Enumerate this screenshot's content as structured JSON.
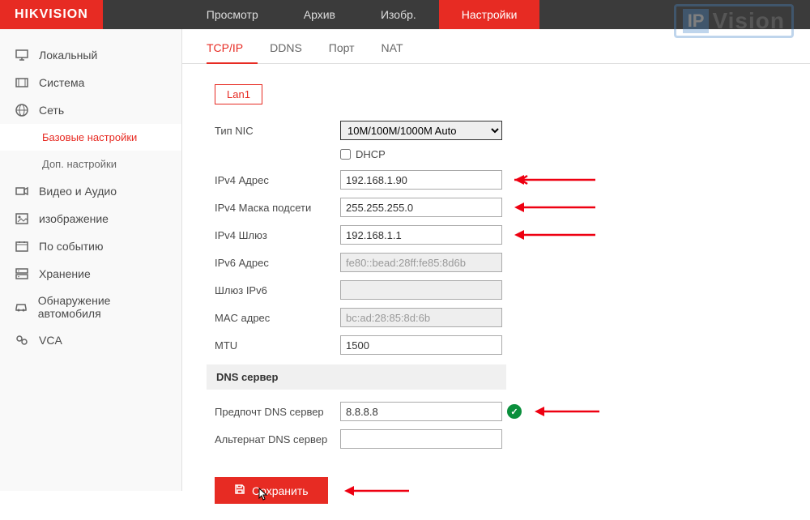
{
  "logo": {
    "part1": "HIK",
    "part2": "VISION"
  },
  "nav": {
    "items": [
      "Просмотр",
      "Архив",
      "Изобр.",
      "Настройки"
    ],
    "activeIndex": 3
  },
  "sidebar": {
    "items": [
      {
        "label": "Локальный",
        "icon": "monitor"
      },
      {
        "label": "Система",
        "icon": "film"
      },
      {
        "label": "Сеть",
        "icon": "globe",
        "children": [
          {
            "label": "Базовые настройки",
            "active": true
          },
          {
            "label": "Доп. настройки",
            "active": false
          }
        ]
      },
      {
        "label": "Видео и Аудио",
        "icon": "video"
      },
      {
        "label": "изображение",
        "icon": "image"
      },
      {
        "label": "По событию",
        "icon": "calendar"
      },
      {
        "label": "Хранение",
        "icon": "storage"
      },
      {
        "label": "Обнаружение автомобиля",
        "icon": "car"
      },
      {
        "label": "VCA",
        "icon": "vca"
      }
    ]
  },
  "tabs": {
    "items": [
      "TCP/IP",
      "DDNS",
      "Порт",
      "NAT"
    ],
    "activeIndex": 0
  },
  "lan": {
    "label": "Lan1"
  },
  "form": {
    "nicType": {
      "label": "Тип NIC",
      "value": "10M/100M/1000M Auto"
    },
    "dhcp": {
      "label": "DHCP",
      "checked": false
    },
    "ipv4Address": {
      "label": "IPv4 Адрес",
      "value": "192.168.1.90"
    },
    "ipv4Mask": {
      "label": "IPv4 Маска подсети",
      "value": "255.255.255.0"
    },
    "ipv4Gateway": {
      "label": "IPv4 Шлюз",
      "value": "192.168.1.1"
    },
    "ipv6Address": {
      "label": "IPv6 Адрес",
      "value": "fe80::bead:28ff:fe85:8d6b"
    },
    "ipv6Gateway": {
      "label": "Шлюз IPv6",
      "value": ""
    },
    "macAddress": {
      "label": "MAC адрес",
      "value": "bc:ad:28:85:8d:6b"
    },
    "mtu": {
      "label": "MTU",
      "value": "1500"
    },
    "dnsSection": "DNS сервер",
    "preferredDns": {
      "label": "Предпочт DNS сервер",
      "value": "8.8.8.8"
    },
    "alternateDns": {
      "label": "Альтернат DNS сервер",
      "value": ""
    }
  },
  "saveBtn": {
    "label": "Сохранить"
  },
  "watermark": {
    "ip": "IP",
    "vision": "Vision"
  }
}
